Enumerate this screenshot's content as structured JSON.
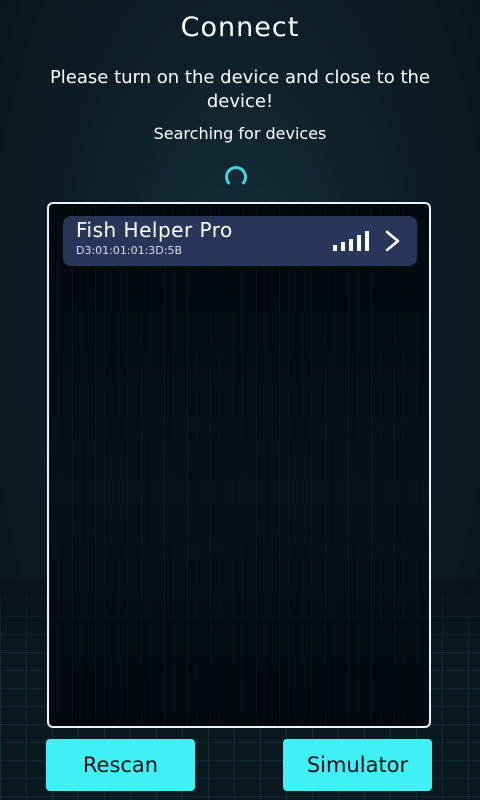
{
  "header": {
    "title": "Connect",
    "instruction": "Please turn on the device and close to the device!",
    "status": "Searching for devices"
  },
  "devices": [
    {
      "name": "Fish Helper Pro",
      "mac": "D3:01:01:01:3D:5B",
      "signal_bars": 5,
      "icon": "chevron-right-icon"
    }
  ],
  "actions": {
    "rescan_label": "Rescan",
    "simulator_label": "Simulator"
  },
  "colors": {
    "accent": "#3ff0f5",
    "card": "#28365a",
    "spinner": "#3fd6e0"
  }
}
